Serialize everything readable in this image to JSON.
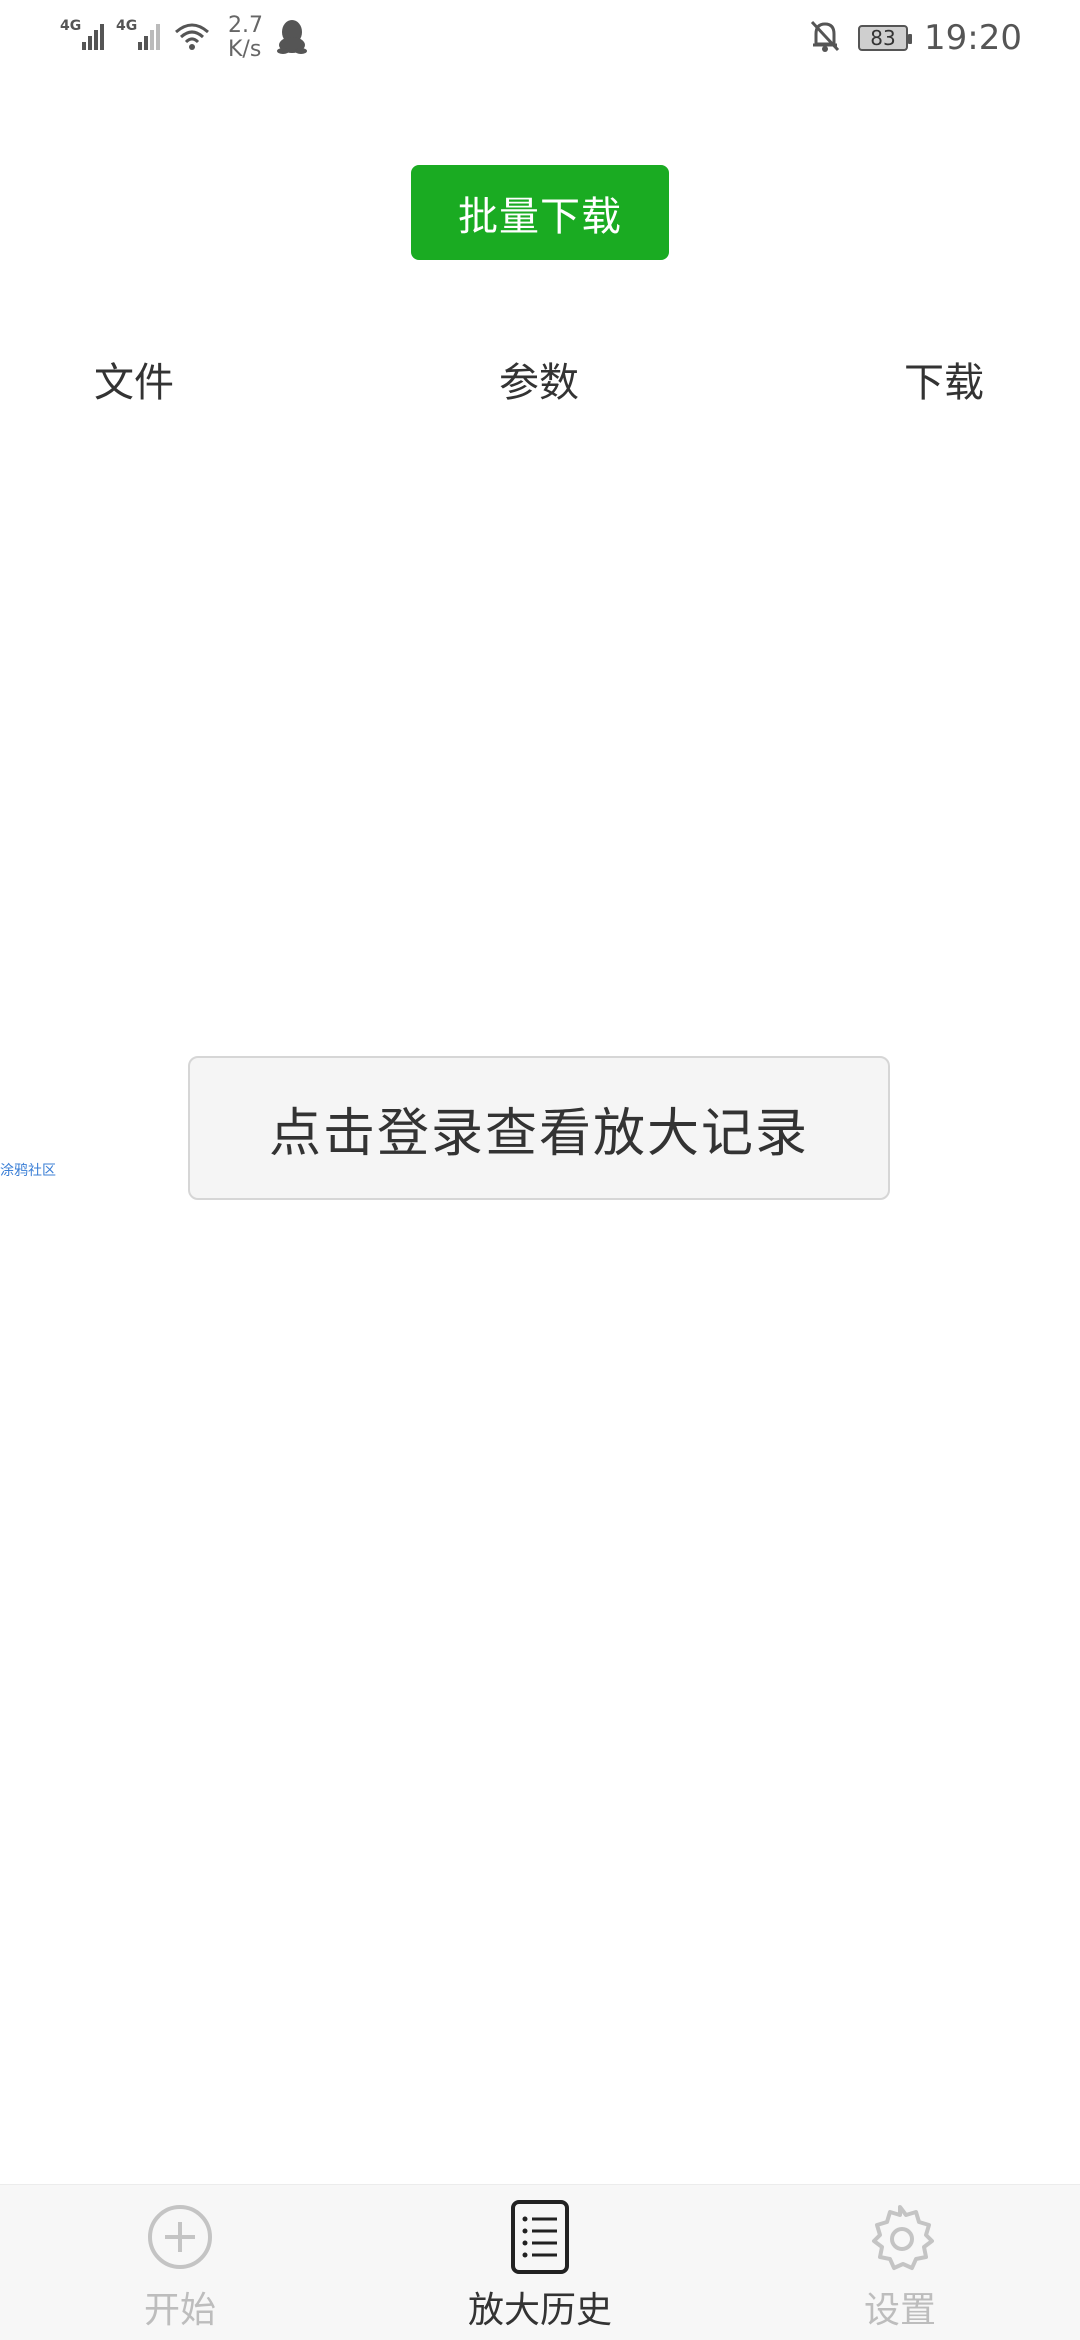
{
  "status_bar": {
    "signal1_label": "4G",
    "signal2_label": "4G",
    "net_speed_value": "2.7",
    "net_speed_unit": "K/s",
    "battery_level": "83",
    "time": "19:20",
    "icons": [
      "signal-4g-icon",
      "signal-4g-icon",
      "wifi-icon",
      "qq-icon",
      "bell-muted-icon",
      "battery-icon"
    ]
  },
  "toolbar": {
    "batch_download_label": "批量下载",
    "accent_color": "#1aab22"
  },
  "columns": {
    "file": "文件",
    "params": "参数",
    "download": "下载"
  },
  "login_prompt": "点击登录查看放大记录",
  "side_link": "涂鸦社区",
  "bottom_nav": {
    "items": [
      {
        "label": "开始",
        "icon": "plus-circle-icon",
        "active": false
      },
      {
        "label": "放大历史",
        "icon": "list-document-icon",
        "active": true
      },
      {
        "label": "设置",
        "icon": "gear-icon",
        "active": false
      }
    ]
  }
}
